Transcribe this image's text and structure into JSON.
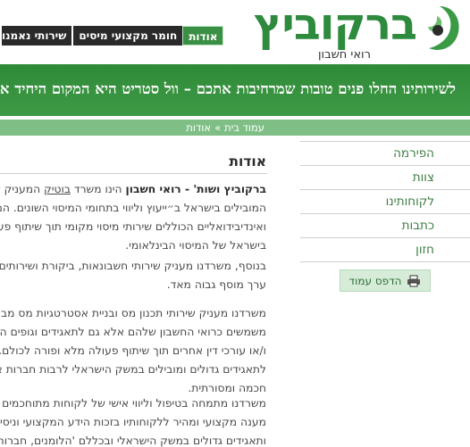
{
  "header": {
    "logo_title": "ברקוביץ",
    "logo_subtitle": "רואי חשבון",
    "nav": [
      {
        "label": "אודות",
        "active": true
      },
      {
        "label": "חומר מקצועי מיסים",
        "active": false
      },
      {
        "label": "שירותי נאמנו",
        "active": false
      }
    ]
  },
  "banner": {
    "text": "לשירותינו החלו פנים טובות שמרחיבות אתכם – וול סטריט היא המקום היחיד אליו נוסעים אנשים ברולס רויס, כדי לקבל ייעוץ"
  },
  "breadcrumb": {
    "home": "עמוד בית",
    "separator": "»",
    "current": "אודות"
  },
  "sidebar": {
    "items": [
      "הפירמה",
      "צוות",
      "לקוחותינו",
      "כתבות",
      "חזון"
    ],
    "print_label": "הדפס עמוד"
  },
  "main": {
    "heading": "אודות",
    "p1_bold": "ברקוביץ ושות' - רואי חשבון",
    "p1_mid": "הינו משרד",
    "p1_link": "בוטיק",
    "p1_rest": "המעניק שירותי ביקורת",
    "p1_lines": [
      "המובילים בישראל ב״ייעוץ וליווי בתחומי המיסוי השונים. המשרד מעניק",
      "ואינדיבידואליים הכוללים שירותי מיסוי מקומי תוך שיתוף פעולה עם מומחים",
      "בישראל של המיסוי הבינלאומי."
    ],
    "p2_lines": [
      "בנוסף, משרדנו מעניק שירותי חשבונאות, ביקורת ושירותים משלימים",
      "ערך מוסף גבוה מאד."
    ],
    "p3_lines": [
      "משרדנו מעניק שירותי תכנון מס ובניית אסטרטגיות מס מבונות לא",
      "משמשים כרואי החשבון שלהם אלא גם לתאגידים וגופים המופנים אלינו",
      "ו/או עורכי דין אחרים תוך שיתוף פעולה מלא ופורה לכולם. משרדנו",
      "לתאגידים גדולים ומובילים במשק הישראלי לרבות חברות אנרגיה,",
      "חכמה ומסורתית."
    ],
    "p4_lines": [
      "משרדנו מתמחה בטיפול וליווי אישי של לקוחות מתוחכמים הצורכים",
      "מענה מקצועי ומהיר ללקוחותיו בזכות הידע המקצועי וניסיון הרב. ב",
      "ותאגידים גדולים במשק הישראלי ובכללם 'הלומנים, חברות נדל\"ן,"
    ]
  }
}
